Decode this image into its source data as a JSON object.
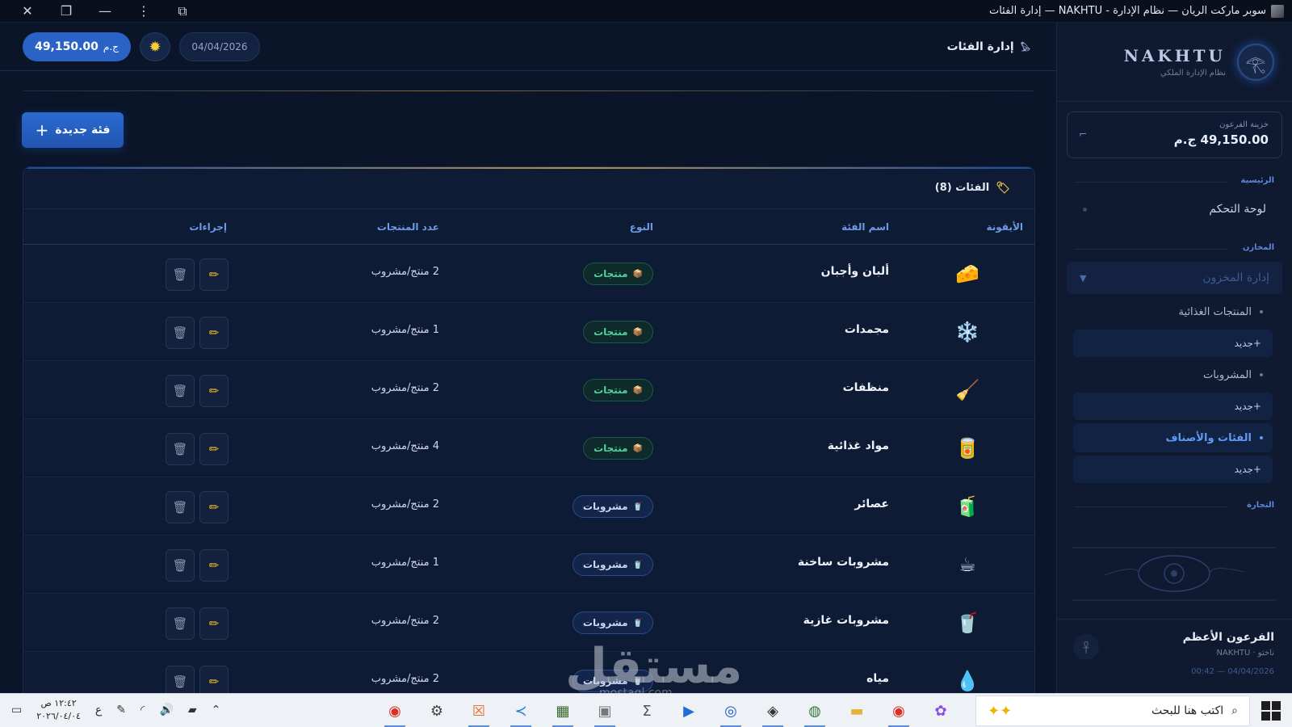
{
  "window": {
    "title": "سوبر ماركت الريان — نظام الإدارة - NAKHTU — إدارة الفئات"
  },
  "sidebar": {
    "brand_name": "NAKHTU",
    "brand_subtitle": "نظام الإدارة الملكي",
    "treasury_label": "خزينة الفرعون",
    "treasury_value": "49,150.00 ج.م",
    "section_main": "الرئيسية",
    "dashboard": "لوحة التحكم",
    "section_stores": "المخازن",
    "inventory_group": "إدارة المخزون",
    "food_products": "المنتجات الغذائية",
    "new_label": "+جديد",
    "drinks": "المشروبات",
    "categories": "الفئات والأصناف",
    "section_trade": "التجارة",
    "user_name": "الفرعون الأعظم",
    "user_role": "ناختو · NAKHTU",
    "user_time": "04/04/2026 — 00:42"
  },
  "topbar": {
    "page_title": "إدارة الفئات",
    "date": "04/04/2026",
    "balance_amount": "49,150.00",
    "balance_currency": "ج.م"
  },
  "main": {
    "new_button": "فئة جديدة",
    "card_title": "الفئات (8)",
    "columns": {
      "icon": "الأيقونة",
      "name": "اسم الفئة",
      "type": "النوع",
      "count": "عدد المنتجات",
      "actions": "إجراءات"
    },
    "rows": [
      {
        "icon": "🧀",
        "name": "ألبان وأجبان",
        "type": "منتجات",
        "type_kind": "products",
        "count": "2 منتج/مشروب"
      },
      {
        "icon": "❄️",
        "name": "مجمدات",
        "type": "منتجات",
        "type_kind": "products",
        "count": "1 منتج/مشروب"
      },
      {
        "icon": "🧹",
        "name": "منظفات",
        "type": "منتجات",
        "type_kind": "products",
        "count": "2 منتج/مشروب"
      },
      {
        "icon": "🥫",
        "name": "مواد غذائية",
        "type": "منتجات",
        "type_kind": "products",
        "count": "4 منتج/مشروب"
      },
      {
        "icon": "🧃",
        "name": "عصائر",
        "type": "مشروبات",
        "type_kind": "drinks",
        "count": "2 منتج/مشروب"
      },
      {
        "icon": "☕",
        "name": "مشروبات ساخنة",
        "type": "مشروبات",
        "type_kind": "drinks",
        "count": "1 منتج/مشروب"
      },
      {
        "icon": "🥤",
        "name": "مشروبات غازية",
        "type": "مشروبات",
        "type_kind": "drinks",
        "count": "2 منتج/مشروب"
      },
      {
        "icon": "💧",
        "name": "مياه",
        "type": "مشروبات",
        "type_kind": "drinks",
        "count": "2 منتج/مشروب"
      }
    ]
  },
  "taskbar": {
    "search_placeholder": "اكتب هنا للبحث",
    "time": "١٢:٤٢ ص",
    "date": "٢٠٢٦/٠٤/٠٤",
    "lang": "ع"
  },
  "watermark": {
    "text": "مستقل",
    "sub": "mostaql.com"
  },
  "colors": {
    "accent": "#2a63c5",
    "products_badge": "#4ed39a",
    "gold": "#b39145"
  }
}
